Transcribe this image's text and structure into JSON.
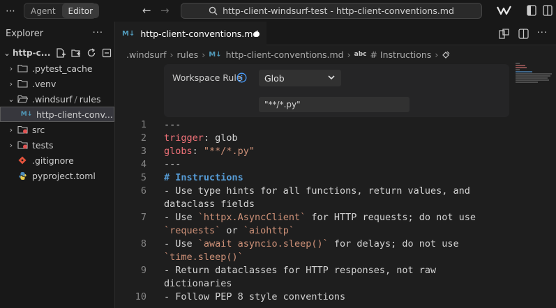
{
  "titlebar": {
    "agent_label": "Agent",
    "editor_label": "Editor",
    "command_center": "http-client-windsurf-test - http-client-conventions.md"
  },
  "sidebar": {
    "title": "Explorer",
    "root": "http-c...",
    "items": [
      {
        "label": ".pytest_cache",
        "kind": "folder"
      },
      {
        "label": ".venv",
        "kind": "folder"
      },
      {
        "label": ".windsurf",
        "sub": "rules",
        "kind": "folder-open"
      },
      {
        "label": "http-client-conv...",
        "kind": "md-file"
      },
      {
        "label": "src",
        "kind": "folder"
      },
      {
        "label": "tests",
        "kind": "folder"
      },
      {
        "label": ".gitignore",
        "kind": "git"
      },
      {
        "label": "pyproject.toml",
        "kind": "toml"
      }
    ]
  },
  "tab": {
    "badge": "M↓",
    "name": "http-client-conventions.md"
  },
  "breadcrumb": {
    "p1": ".windsurf",
    "p2": "rules",
    "md": "M↓",
    "p3": "http-client-conventions.md",
    "abc": "abc",
    "p4": "# Instructions"
  },
  "rule": {
    "label": "Workspace Rule",
    "mode": "Glob",
    "glob": "\"**/*.py\""
  },
  "code": {
    "n1": "1",
    "n2": "2",
    "n3": "3",
    "n4": "4",
    "n5": "5",
    "n6": "6",
    "n7": "7",
    "n8": "8",
    "n9": "9",
    "n10": "10",
    "l1": "---",
    "l2_key": "trigger",
    "l2_rest": ": glob",
    "l3_key": "globs",
    "l3_colon": ": ",
    "l3_val": "\"**/*.py\"",
    "l4": "---",
    "l5": "# Instructions",
    "l6a": "- Use type hints for all functions, return values, and",
    "l6b": "dataclass fields",
    "l7_pre": "- Use ",
    "l7_code1": "`httpx.AsyncClient`",
    "l7_mid": " for HTTP requests; do not use",
    "l7_code2": "`requests`",
    "l7_or": " or ",
    "l7_code3": "`aiohttp`",
    "l8_pre": "- Use ",
    "l8_code1": "`await asyncio.sleep()`",
    "l8_mid": " for delays; do not use",
    "l8_code2": "`time.sleep()`",
    "l9a": "- Return dataclasses for HTTP responses, not raw",
    "l9b": "dictionaries",
    "l10": "- Follow PEP 8 style conventions"
  },
  "colors": {
    "accent_md": "#519aba",
    "key": "#f07178",
    "string": "#ce9178",
    "heading": "#569cd6"
  }
}
